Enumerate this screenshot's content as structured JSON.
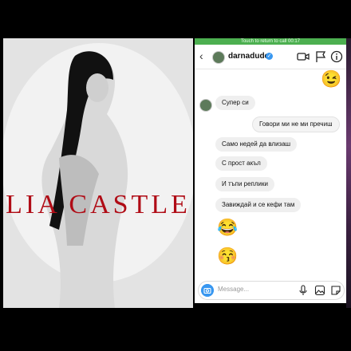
{
  "poster": {
    "title": "LIA CASTLE"
  },
  "status_bar": {
    "text": "Touch to return to call 00:17"
  },
  "chat": {
    "username": "darnadude",
    "verified_mark": "✓",
    "back_glyph": "‹",
    "icons": [
      "back-arrow-icon",
      "video-call-icon",
      "flag-icon",
      "info-icon"
    ],
    "messages": [
      {
        "side": "sent",
        "type": "emoji",
        "text": "😉"
      },
      {
        "side": "received",
        "type": "text",
        "text": "Супер си"
      },
      {
        "side": "sent",
        "type": "text",
        "text": "Говори ми не ми пречиш"
      },
      {
        "side": "received",
        "type": "text",
        "text": "Само недей да влизаш"
      },
      {
        "side": "received",
        "type": "text",
        "text": "С прост акъл"
      },
      {
        "side": "received",
        "type": "text",
        "text": "И тъпи реплики"
      },
      {
        "side": "received",
        "type": "text",
        "text": "Завиждай и се кефи там"
      },
      {
        "side": "received",
        "type": "emoji",
        "text": "😂"
      },
      {
        "side": "received",
        "type": "emoji",
        "text": "😚"
      }
    ],
    "composer": {
      "placeholder": "Message...",
      "icons": [
        "camera-icon",
        "microphone-icon",
        "gallery-icon",
        "sticker-icon"
      ]
    }
  },
  "colors": {
    "poster_title": "#b00c16",
    "status_bar": "#4caf50",
    "accent": "#3897f0"
  }
}
